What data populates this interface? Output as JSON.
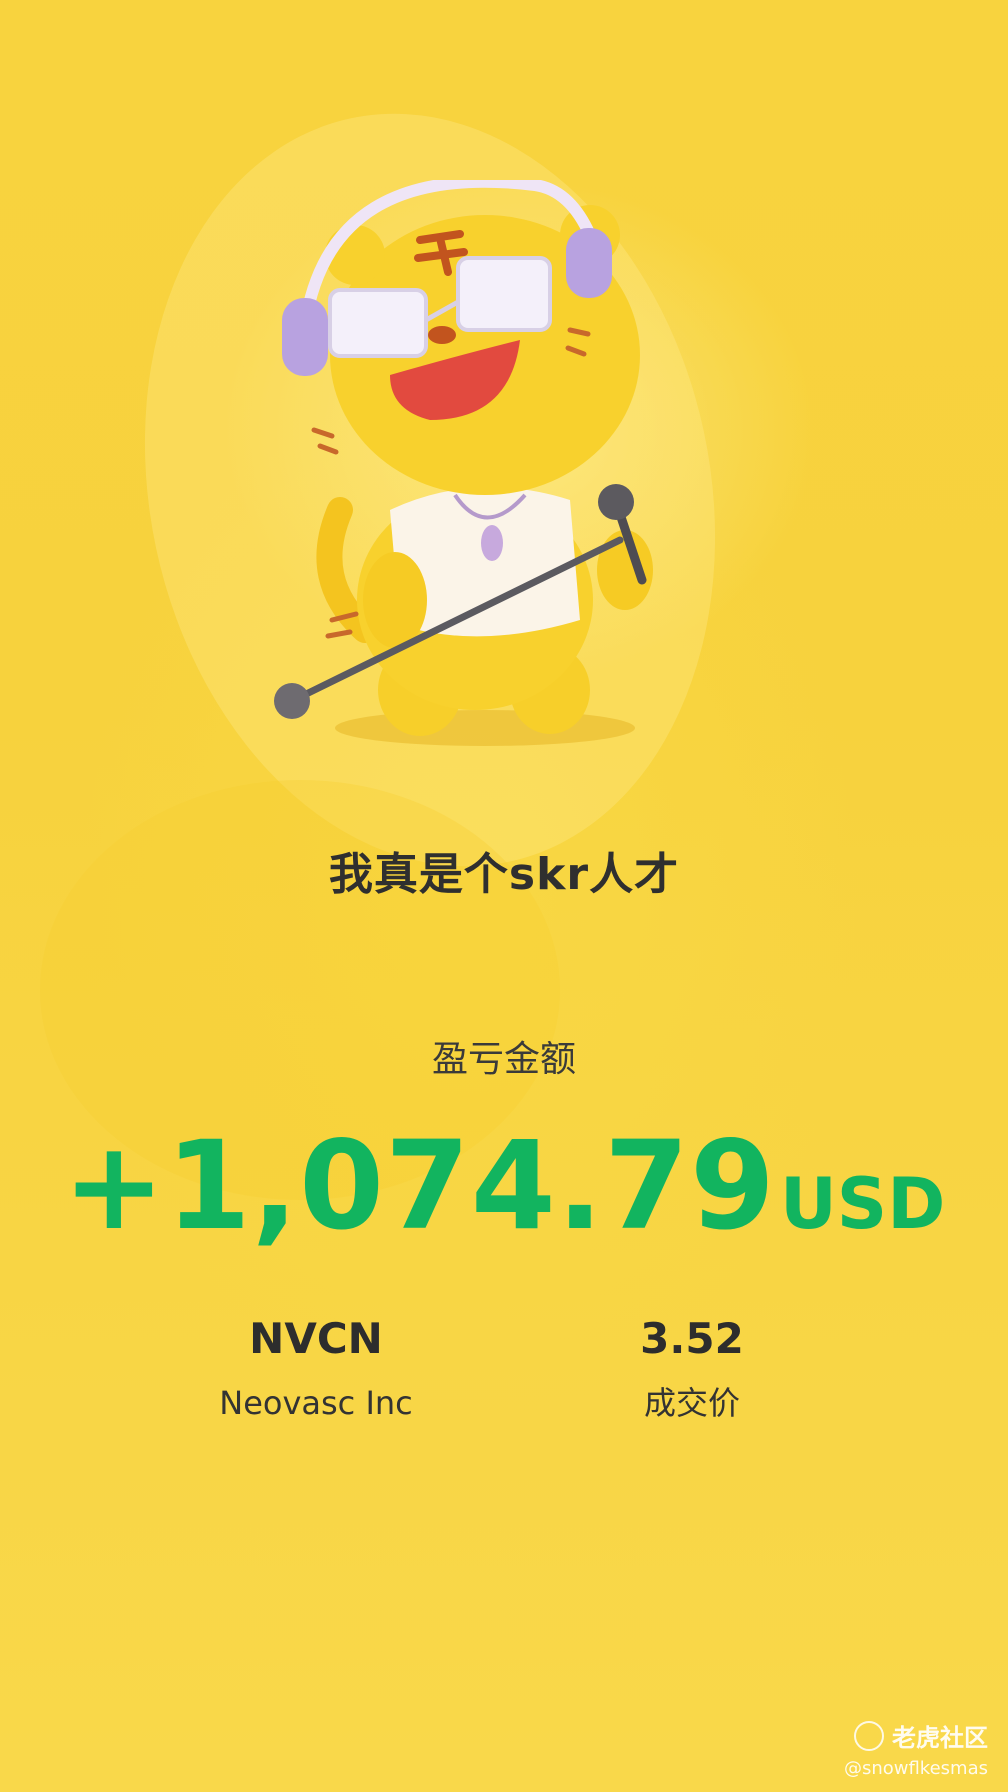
{
  "share_card": {
    "slogan": "我真是个skr人才",
    "pnl_label": "盈亏金额",
    "pnl_amount": "+1,074.79",
    "pnl_currency": "USD",
    "stock_symbol": "NVCN",
    "stock_name": "Neovasc Inc",
    "trade_price": "3.52",
    "trade_price_label": "成交价"
  },
  "watermark": {
    "brand": "老虎社区",
    "user": "@snowflkesmas"
  },
  "colors": {
    "background": "#f8d33e",
    "profit": "#12b45f",
    "text_dark": "#2f2f2f"
  },
  "icons": {
    "mascot": "tiger-mascot-singer-with-headphones-and-microphone",
    "watermark_logo": "tiger-community-logo-icon"
  }
}
